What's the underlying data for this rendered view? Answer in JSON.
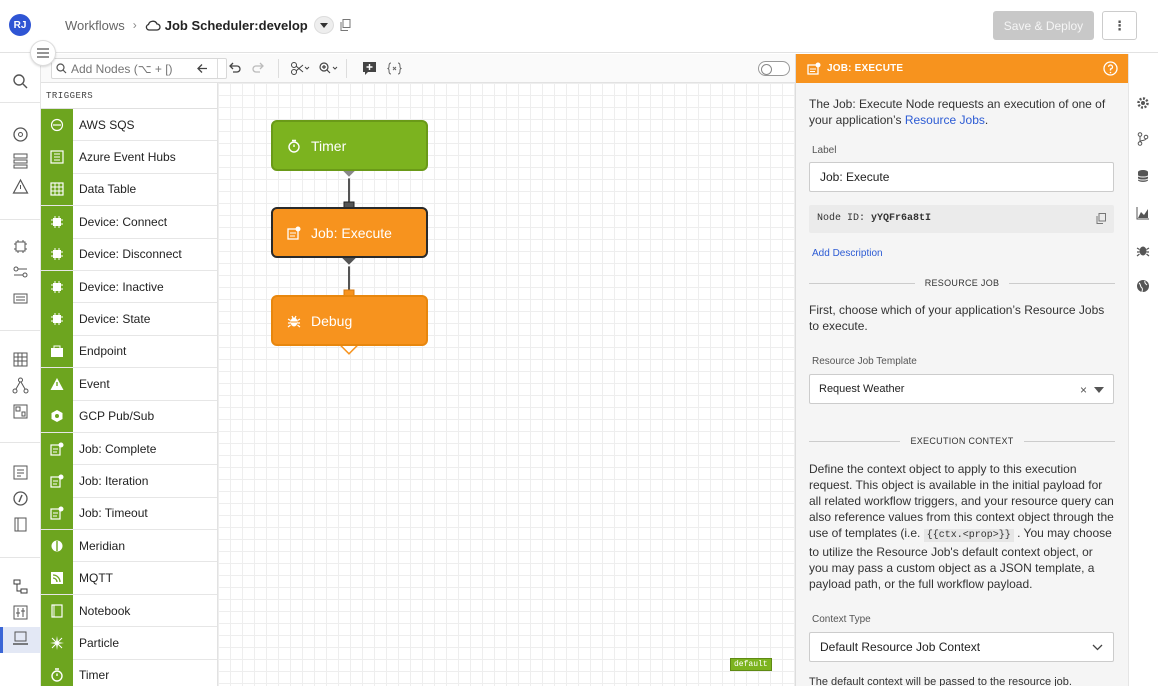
{
  "header": {
    "avatar_initials": "RJ",
    "breadcrumb_root": "Workflows",
    "breadcrumb_sep": "›",
    "current_title": "Job Scheduler:develop",
    "save_deploy_label": "Save & Deploy",
    "more_label": "⋮"
  },
  "toolbar": {
    "add_nodes_placeholder": "Add Nodes (⌥ + [)"
  },
  "palette": {
    "section_title": "TRIGGERS",
    "items": [
      {
        "label": "AWS SQS",
        "icon": "sqs-icon"
      },
      {
        "label": "Azure Event Hubs",
        "icon": "event-hubs-icon"
      },
      {
        "label": "Data Table",
        "icon": "table-icon"
      },
      {
        "label": "Device: Connect",
        "icon": "device-connect-icon"
      },
      {
        "label": "Device: Disconnect",
        "icon": "device-disconnect-icon"
      },
      {
        "label": "Device: Inactive",
        "icon": "device-inactive-icon"
      },
      {
        "label": "Device: State",
        "icon": "device-state-icon"
      },
      {
        "label": "Endpoint",
        "icon": "endpoint-icon"
      },
      {
        "label": "Event",
        "icon": "warning-icon"
      },
      {
        "label": "GCP Pub/Sub",
        "icon": "gcp-icon"
      },
      {
        "label": "Job: Complete",
        "icon": "job-complete-icon"
      },
      {
        "label": "Job: Iteration",
        "icon": "job-iteration-icon"
      },
      {
        "label": "Job: Timeout",
        "icon": "job-timeout-icon"
      },
      {
        "label": "Meridian",
        "icon": "meridian-icon"
      },
      {
        "label": "MQTT",
        "icon": "mqtt-icon"
      },
      {
        "label": "Notebook",
        "icon": "notebook-icon"
      },
      {
        "label": "Particle",
        "icon": "particle-icon"
      },
      {
        "label": "Timer",
        "icon": "timer-icon"
      }
    ]
  },
  "canvas": {
    "nodes": [
      {
        "label": "Timer",
        "icon": "timer-icon",
        "color": "#7cb31f"
      },
      {
        "label": "Job: Execute",
        "icon": "job-execute-icon",
        "color": "#f7931e"
      },
      {
        "label": "Debug",
        "icon": "bug-icon",
        "color": "#f7931e"
      }
    ],
    "default_tag": "default"
  },
  "panel": {
    "title": "JOB: EXECUTE",
    "intro_pre": "The Job: Execute Node requests an execution of one of your application’s ",
    "intro_link": "Resource Jobs",
    "intro_post": ".",
    "label_field_label": "Label",
    "label_value": "Job: Execute",
    "node_id_label": "Node ID:",
    "node_id_value": "yYQFr6a8tI",
    "add_description": "Add Description",
    "resource_job_heading": "RESOURCE JOB",
    "resource_job_text": "First, choose which of your application’s Resource Jobs to execute.",
    "template_label": "Resource Job Template",
    "template_value": "Request Weather",
    "exec_context_heading": "EXECUTION CONTEXT",
    "exec_text_1": "Define the context object to apply to this execution request. This object is available in the initial payload for all related workflow triggers, and your resource query can also reference values from this context object through the use of templates (i.e. ",
    "exec_code": "{{ctx.<prop>}}",
    "exec_text_2": " . You may choose to utilize the Resource Job's default context object, or you may pass a custom object as a JSON template, a payload path, or the full workflow payload.",
    "context_type_label": "Context Type",
    "context_type_value": "Default Resource Job Context",
    "footer_note": "The default context will be passed to the resource job."
  },
  "colors": {
    "accent_orange": "#f7931e",
    "trigger_green": "#6da51f",
    "link_blue": "#2c5bd4"
  }
}
